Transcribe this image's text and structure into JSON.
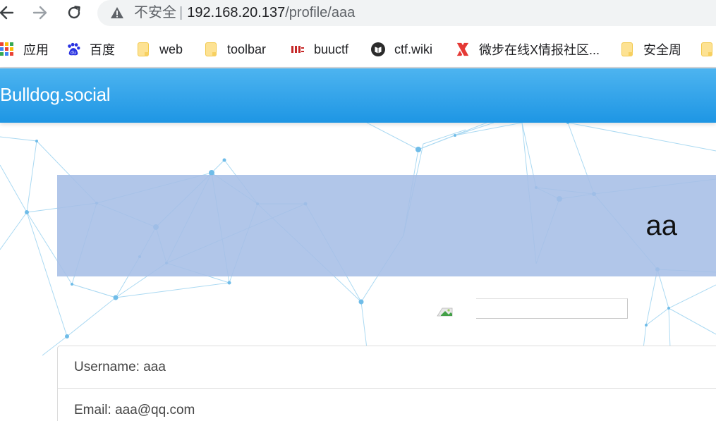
{
  "browser": {
    "security_label": "不安全",
    "url_host": "192.168.20.137",
    "url_path": "/profile/aaa",
    "bookmarks": [
      {
        "label": "应用",
        "icon": "apps-grid-icon"
      },
      {
        "label": "百度",
        "icon": "baidu-paw-icon"
      },
      {
        "label": "web",
        "icon": "folder-icon"
      },
      {
        "label": "toolbar",
        "icon": "folder-icon"
      },
      {
        "label": "buuctf",
        "icon": "buuctf-icon"
      },
      {
        "label": "ctf.wiki",
        "icon": "ctfwiki-icon"
      },
      {
        "label": "微步在线X情报社区...",
        "icon": "threatbook-x-icon"
      },
      {
        "label": "安全周",
        "icon": "folder-icon"
      }
    ]
  },
  "page": {
    "brand": "Bulldog.social",
    "profile_name": "aa",
    "details": {
      "username_row": "Username: aaa",
      "email_row": "Email: aaa@qq.com"
    }
  },
  "colors": {
    "navbar_top": "#4db4f0",
    "navbar_bottom": "#1e96e4",
    "jumbotron": "#a6bee6",
    "network_lines": "#7cc4ea"
  }
}
